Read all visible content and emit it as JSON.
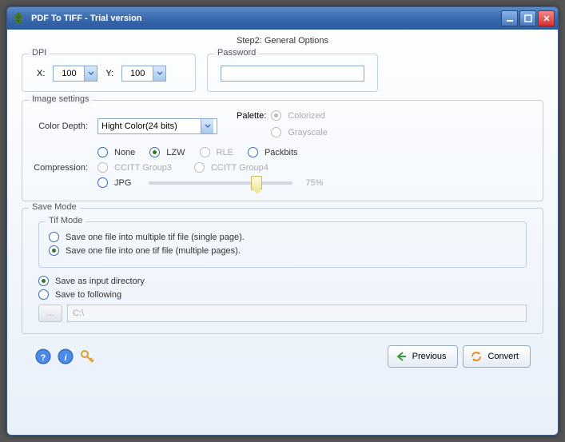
{
  "window": {
    "title": "PDF To TIFF - Trial version"
  },
  "step": "Step2: General Options",
  "dpi": {
    "legend": "DPI",
    "x_label": "X:",
    "x_value": "100",
    "y_label": "Y:",
    "y_value": "100"
  },
  "password": {
    "legend": "Password",
    "value": ""
  },
  "imageSettings": {
    "legend": "Image settings",
    "colorDepthLabel": "Color Depth:",
    "colorDepthValue": "Hight Color(24 bits)",
    "paletteLabel": "Palette:",
    "paletteOptions": {
      "colorized": "Colorized",
      "grayscale": "Grayscale"
    },
    "compressionLabel": "Compression:",
    "compression": {
      "none": "None",
      "lzw": "LZW",
      "rle": "RLE",
      "packbits": "Packbits",
      "ccitt3": "CCITT Group3",
      "ccitt4": "CCITT Group4",
      "jpg": "JPG"
    },
    "jpgQuality": "75%"
  },
  "saveMode": {
    "legend": "Save Mode",
    "tifModeLegend": "Tif Mode",
    "opt1": "Save one file into multiple tif file (single page).",
    "opt2": "Save one file into one tif file (multiple pages).",
    "saveInput": "Save as input directory",
    "saveFollowing": "Save to following",
    "browse": "...",
    "path": "C:\\"
  },
  "footer": {
    "previous": "Previous",
    "convert": "Convert"
  }
}
